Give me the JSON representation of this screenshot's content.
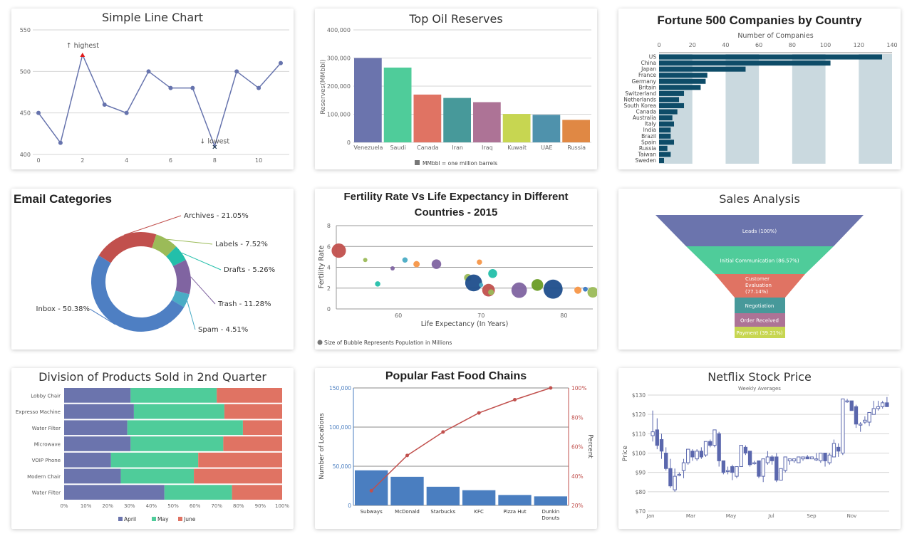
{
  "charts": {
    "line": {
      "chart_data": {
        "type": "line",
        "title": "Simple Line Chart",
        "x": [
          0,
          1,
          2,
          3,
          4,
          5,
          6,
          7,
          8,
          9,
          10,
          11
        ],
        "values": [
          450,
          414,
          520,
          460,
          450,
          500,
          480,
          480,
          410,
          500,
          480,
          510
        ],
        "xticks": [
          "0",
          "2",
          "4",
          "6",
          "8",
          "10"
        ],
        "yticks": [
          "400",
          "450",
          "500",
          "550"
        ],
        "ylim": [
          400,
          550
        ],
        "annotations": [
          {
            "x": 2,
            "label": "↑ highest"
          },
          {
            "x": 8,
            "label": "↓ lowest"
          }
        ],
        "color": "#6673ad",
        "highlight_color": "#e01a1a"
      }
    },
    "oil": {
      "chart_data": {
        "type": "bar",
        "title": "Top Oil Reserves",
        "categories": [
          "Venezuela",
          "Saudi",
          "Canada",
          "Iran",
          "Iraq",
          "Kuwait",
          "UAE",
          "Russia"
        ],
        "values": [
          300000,
          266000,
          170000,
          158000,
          143000,
          101000,
          98000,
          80000
        ],
        "colors": [
          "#6b74ad",
          "#4fcc9a",
          "#e07363",
          "#47999a",
          "#ad7396",
          "#c7d651",
          "#4f92ac",
          "#e08844"
        ],
        "ylabel": "Reserves(MMbbl)",
        "ylim": [
          0,
          400000
        ],
        "yticks": [
          "0",
          "100,000",
          "200,000",
          "300,000",
          "400,000"
        ],
        "legend": "MMbbl = one million barrels"
      }
    },
    "fortune": {
      "chart_data": {
        "type": "bar",
        "orientation": "horizontal",
        "title": "Fortune 500 Companies by Country",
        "xlabel": "Number of Companies",
        "categories": [
          "US",
          "China",
          "Japan",
          "France",
          "Germany",
          "Britain",
          "Switzerland",
          "Netherlands",
          "South Korea",
          "Canada",
          "Australia",
          "Italy",
          "India",
          "Brazil",
          "Spain",
          "Russia",
          "Taiwan",
          "Sweden"
        ],
        "values": [
          134,
          103,
          52,
          29,
          28,
          25,
          15,
          12,
          15,
          11,
          8,
          9,
          7,
          7,
          9,
          5,
          7,
          3
        ],
        "xlim": [
          0,
          140
        ],
        "xticks": [
          "0",
          "20",
          "40",
          "60",
          "80",
          "100",
          "120",
          "140"
        ],
        "color": "#0e4c68",
        "band_color": "#cad9df"
      }
    },
    "email": {
      "chart_data": {
        "type": "pie",
        "variant": "doughnut",
        "title": "Email Categories",
        "slices": [
          {
            "label": "Inbox - 50.38%",
            "value": 50.38,
            "color": "#4e7fc3"
          },
          {
            "label": "Archives - 21.05%",
            "value": 21.05,
            "color": "#c1504d"
          },
          {
            "label": "Labels - 7.52%",
            "value": 7.52,
            "color": "#9bbb58"
          },
          {
            "label": "Drafts - 5.26%",
            "value": 5.26,
            "color": "#23bfaa"
          },
          {
            "label": "Trash - 11.28%",
            "value": 11.28,
            "color": "#8064a1"
          },
          {
            "label": "Spam - 4.51%",
            "value": 4.51,
            "color": "#4aacc5"
          }
        ]
      }
    },
    "bubble": {
      "chart_data": {
        "type": "scatter",
        "variant": "bubble",
        "title_line1": "Fertility Rate Vs Life Expectancy in Different",
        "title_line2": "Countries - 2015",
        "xlabel": "Life Expectancy (In Years)",
        "ylabel": "Fertility Rate",
        "xlim": [
          52.5,
          83.5
        ],
        "ylim": [
          0,
          8
        ],
        "xticks": [
          "60",
          "70",
          "80"
        ],
        "yticks": [
          "0",
          "2",
          "4",
          "6",
          "8"
        ],
        "legend": "Size of Bubble Represents Population in Millions",
        "points": [
          {
            "x": 52.8,
            "y": 5.6,
            "size": 180,
            "color": "#c1504d"
          },
          {
            "x": 56.0,
            "y": 4.7,
            "size": 8,
            "color": "#9bbb58"
          },
          {
            "x": 57.5,
            "y": 2.4,
            "size": 25,
            "color": "#23bfaa"
          },
          {
            "x": 59.3,
            "y": 3.9,
            "size": 10,
            "color": "#8064a1"
          },
          {
            "x": 60.8,
            "y": 4.7,
            "size": 25,
            "color": "#4aacc5"
          },
          {
            "x": 62.2,
            "y": 4.3,
            "size": 35,
            "color": "#f79647"
          },
          {
            "x": 64.6,
            "y": 4.3,
            "size": 80,
            "color": "#8064a1"
          },
          {
            "x": 68.4,
            "y": 3.0,
            "size": 50,
            "color": "#9bbb58"
          },
          {
            "x": 69.1,
            "y": 2.5,
            "size": 250,
            "color": "#1f4e8c"
          },
          {
            "x": 69.8,
            "y": 4.5,
            "size": 25,
            "color": "#f79647"
          },
          {
            "x": 70.0,
            "y": 2.3,
            "size": 15,
            "color": "#4aacc5"
          },
          {
            "x": 70.9,
            "y": 1.8,
            "size": 140,
            "color": "#c1504d"
          },
          {
            "x": 71.2,
            "y": 1.6,
            "size": 30,
            "color": "#9bbb58"
          },
          {
            "x": 71.4,
            "y": 3.4,
            "size": 70,
            "color": "#23bfaa"
          },
          {
            "x": 74.6,
            "y": 1.8,
            "size": 210,
            "color": "#8064a1"
          },
          {
            "x": 76.8,
            "y": 2.3,
            "size": 120,
            "color": "#6a9c25"
          },
          {
            "x": 78.7,
            "y": 1.9,
            "size": 320,
            "color": "#1f4e8c"
          },
          {
            "x": 81.7,
            "y": 1.8,
            "size": 45,
            "color": "#f79647"
          },
          {
            "x": 82.6,
            "y": 1.9,
            "size": 20,
            "color": "#3a78c3"
          },
          {
            "x": 83.5,
            "y": 1.6,
            "size": 100,
            "color": "#9bbb58"
          }
        ]
      }
    },
    "funnel": {
      "chart_data": {
        "type": "funnel",
        "title": "Sales Analysis",
        "stages": [
          {
            "label": "Leads (100%)",
            "value": 100,
            "color": "#6b74ad"
          },
          {
            "label": "Initial Communication (86.57%)",
            "value": 86.57,
            "color": "#4fcc9a"
          },
          {
            "label": "Customer Evaluation (77.14%)",
            "value": 77.14,
            "color": "#e07363"
          },
          {
            "label": "Negotiation",
            "value": null,
            "color": "#47999a"
          },
          {
            "label": "Order Received",
            "value": null,
            "color": "#ad7396"
          },
          {
            "label": "Payment (39.21%)",
            "value": 39.21,
            "color": "#c7d651"
          }
        ]
      }
    },
    "stacked": {
      "chart_data": {
        "type": "bar",
        "variant": "stacked-100-horizontal",
        "title": "Division of Products Sold in 2nd Quarter",
        "categories": [
          "Lobby Chair",
          "Expresso Machine",
          "Water Filter",
          "Microwave",
          "VOIP Phone",
          "Modern Chair",
          "Water Filter"
        ],
        "series": [
          {
            "name": "April",
            "color": "#6b74ad",
            "values": [
              30.5,
              32,
              29,
              30.5,
              21.5,
              26,
              46
            ]
          },
          {
            "name": "May",
            "color": "#4fcc9a",
            "values": [
              39.5,
              41.5,
              53,
              42.5,
              40,
              33.5,
              31
            ]
          },
          {
            "name": "June",
            "color": "#e07363",
            "values": [
              30,
              26.5,
              18,
              27,
              38.5,
              40.5,
              23
            ]
          }
        ],
        "xticks": [
          "0%",
          "10%",
          "20%",
          "30%",
          "40%",
          "50%",
          "60%",
          "70%",
          "80%",
          "90%",
          "100%"
        ],
        "xlim": [
          0,
          100
        ]
      }
    },
    "pareto": {
      "chart_data": {
        "type": "bar",
        "variant": "pareto",
        "title": "Popular Fast Food Chains",
        "categories": [
          "Subways",
          "McDonald",
          "Starbucks",
          "KFC",
          "Pizza Hut",
          "Dunkin Donuts"
        ],
        "values": [
          44800,
          36500,
          23800,
          19400,
          13300,
          11500
        ],
        "line_values": [
          30,
          54,
          70,
          83,
          92,
          100
        ],
        "ylabel": "Number of Locations",
        "y2label": "Percent",
        "ylim": [
          0,
          150000
        ],
        "y2lim": [
          20,
          100
        ],
        "yticks": [
          "0",
          "50,000",
          "100,000",
          "150,000"
        ],
        "y2ticks": [
          "20%",
          "40%",
          "60%",
          "80%",
          "100%"
        ],
        "bar_color": "#4a7ec0",
        "line_color": "#c1504d"
      }
    },
    "netflix": {
      "chart_data": {
        "type": "candlestick",
        "title": "Netflix Stock Price",
        "subtitle": "Weekly Averages",
        "ylabel": "Price",
        "ylim": [
          70,
          130
        ],
        "yticks": [
          "$70",
          "$80",
          "$90",
          "$100",
          "$110",
          "$120",
          "$130"
        ],
        "xticks": [
          "Jan",
          "Mar",
          "May",
          "Jul",
          "Sep",
          "Nov"
        ],
        "color": "#5a67ad",
        "ohlc": [
          [
            109,
            122,
            106,
            111
          ],
          [
            112,
            118,
            102,
            104
          ],
          [
            107,
            110,
            97,
            101
          ],
          [
            100,
            103,
            91,
            92
          ],
          [
            92,
            97,
            82,
            83
          ],
          [
            81,
            92,
            80,
            88
          ],
          [
            89,
            90,
            88,
            89
          ],
          [
            91,
            97,
            87,
            95
          ],
          [
            95,
            102,
            94,
            102
          ],
          [
            101,
            102,
            96,
            98
          ],
          [
            97,
            102,
            96,
            101
          ],
          [
            101,
            103,
            97,
            98
          ],
          [
            99,
            106,
            98,
            106
          ],
          [
            106,
            107,
            103,
            104
          ],
          [
            104,
            112,
            103,
            112
          ],
          [
            110,
            111,
            93,
            96
          ],
          [
            96,
            96,
            89,
            90
          ],
          [
            91,
            93,
            89,
            91
          ],
          [
            93,
            94,
            86,
            90
          ],
          [
            88,
            93,
            87,
            93
          ],
          [
            93,
            104,
            93,
            104
          ],
          [
            103,
            104,
            99,
            100
          ],
          [
            101,
            101,
            93,
            94
          ],
          [
            95,
            96,
            94,
            95
          ],
          [
            96,
            96,
            87,
            88
          ],
          [
            88,
            97,
            85,
            97
          ],
          [
            95,
            101,
            94,
            98
          ],
          [
            98,
            99,
            94,
            96
          ],
          [
            98,
            100,
            85,
            86
          ],
          [
            86,
            92,
            86,
            92
          ],
          [
            91,
            98,
            90,
            98
          ],
          [
            96,
            96,
            94,
            97
          ],
          [
            96,
            97,
            95,
            97
          ],
          [
            95,
            98,
            95,
            98
          ],
          [
            97,
            98,
            96,
            98
          ],
          [
            98,
            99,
            97,
            97
          ],
          [
            97,
            98,
            97,
            98
          ],
          [
            97,
            100,
            96,
            97
          ],
          [
            96,
            100,
            95,
            100
          ],
          [
            100,
            100,
            93,
            96
          ],
          [
            95,
            100,
            94,
            99
          ],
          [
            98,
            107,
            98,
            105
          ],
          [
            103,
            105,
            98,
            101
          ],
          [
            100,
            128,
            99,
            128
          ],
          [
            127,
            128,
            126,
            127
          ],
          [
            127,
            127,
            122,
            122
          ],
          [
            124,
            125,
            113,
            115
          ],
          [
            115,
            116,
            111,
            115
          ],
          [
            116,
            119,
            115,
            117
          ],
          [
            116,
            121,
            114,
            121
          ],
          [
            120,
            127,
            120,
            123
          ],
          [
            123,
            127,
            122,
            124
          ],
          [
            124,
            127,
            123,
            126
          ],
          [
            126,
            129,
            124,
            124
          ]
        ]
      }
    }
  }
}
